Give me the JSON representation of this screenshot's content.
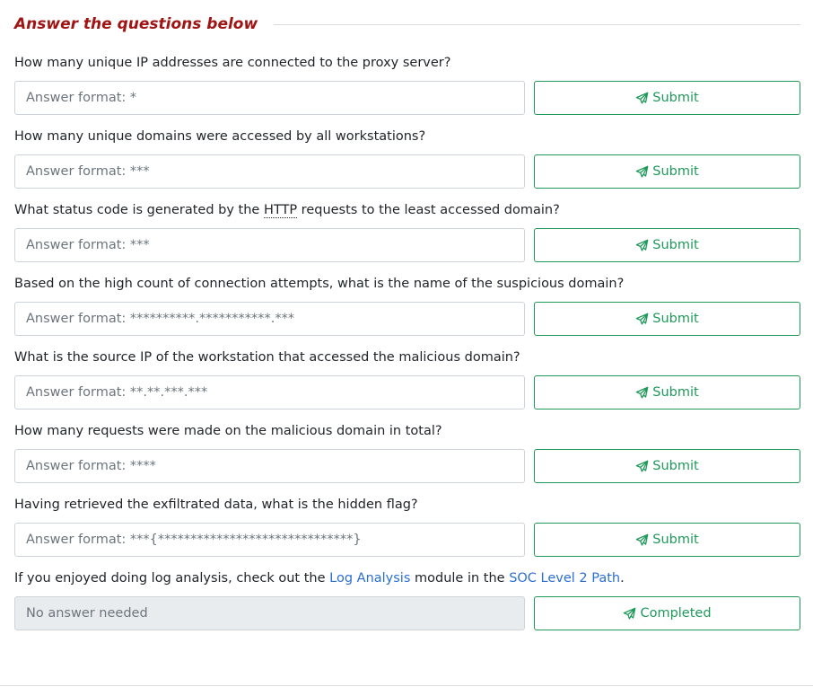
{
  "header": {
    "title": "Answer the questions below"
  },
  "questions": [
    {
      "text": "How many unique IP addresses are connected to the proxy server?",
      "placeholder": "Answer format: *",
      "button_label": "Submit"
    },
    {
      "text": "How many unique domains were accessed by all workstations?",
      "placeholder": "Answer format: ***",
      "button_label": "Submit"
    },
    {
      "text_before": "What status code is generated by the ",
      "abbr": "HTTP",
      "text_after": " requests to the least accessed domain?",
      "placeholder": "Answer format: ***",
      "button_label": "Submit"
    },
    {
      "text": "Based on the high count of connection attempts, what is the name of the suspicious domain?",
      "placeholder": "Answer format: **********.***********.***",
      "button_label": "Submit"
    },
    {
      "text": "What is the source IP of the workstation that accessed the malicious domain?",
      "placeholder": "Answer format: **.**.***.***",
      "button_label": "Submit"
    },
    {
      "text": "How many requests were made on the malicious domain in total?",
      "placeholder": "Answer format: ****",
      "button_label": "Submit"
    },
    {
      "text": "Having retrieved the exfiltrated data, what is the hidden flag?",
      "placeholder": "Answer format: ***{******************************}",
      "button_label": "Submit"
    },
    {
      "text_before": "If you enjoyed doing log analysis, check out the ",
      "link1": "Log Analysis",
      "text_middle": " module in the ",
      "link2": "SOC Level 2 Path",
      "text_after": ".",
      "placeholder": "No answer needed",
      "button_label": "Completed"
    }
  ],
  "icons": {
    "submit": "paper-plane-icon"
  },
  "colors": {
    "title": "#a01414",
    "accent_green": "#1f9a5a",
    "link": "#2c6fd4"
  }
}
